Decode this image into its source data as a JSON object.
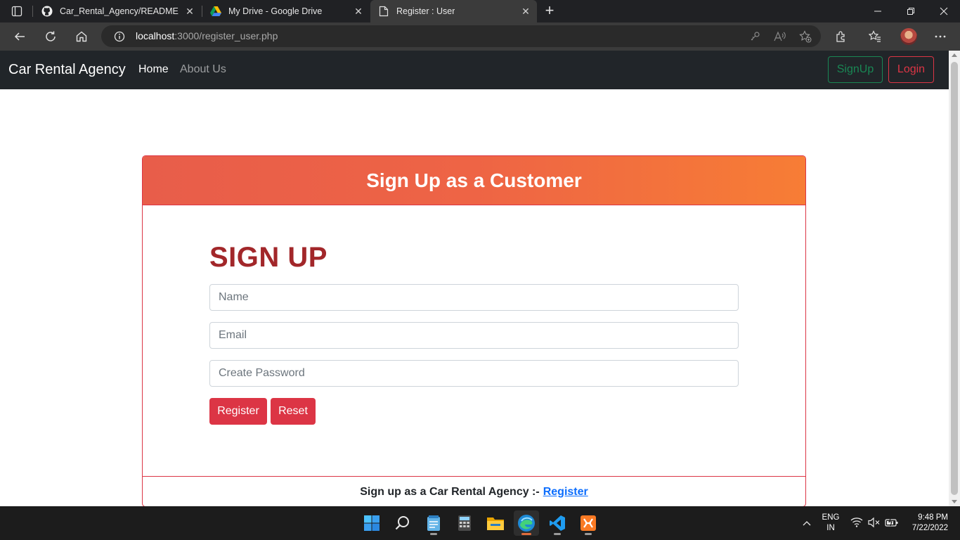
{
  "browser": {
    "tabs": [
      {
        "title": "Car_Rental_Agency/README.md"
      },
      {
        "title": "My Drive - Google Drive"
      },
      {
        "title": "Register : User"
      }
    ],
    "address": {
      "host": "localhost",
      "path": ":3000/register_user.php"
    }
  },
  "navbar": {
    "brand": "Car Rental Agency",
    "links": [
      "Home",
      "About Us"
    ],
    "signup_label": "SignUp",
    "login_label": "Login"
  },
  "card": {
    "header": "Sign Up as a Customer",
    "form_title": "SIGN UP",
    "fields": {
      "name_placeholder": "Name",
      "email_placeholder": "Email",
      "password_placeholder": "Create Password"
    },
    "register_label": "Register",
    "reset_label": "Reset",
    "footer_text": "Sign up as a Car Rental Agency :-",
    "footer_link": "Register"
  },
  "taskbar": {
    "apps": [
      "windows-start",
      "search",
      "notepad",
      "calculator",
      "file-explorer",
      "edge",
      "vscode",
      "xampp"
    ],
    "lang_line1": "ENG",
    "lang_line2": "IN",
    "time": "9:48 PM",
    "date": "7/22/2022"
  },
  "colors": {
    "danger": "#dc3545",
    "success": "#198754",
    "header_gradient_start": "#e85d4a",
    "header_gradient_end": "#f77d35",
    "title_red": "#a2272a",
    "link": "#0d6efd"
  }
}
